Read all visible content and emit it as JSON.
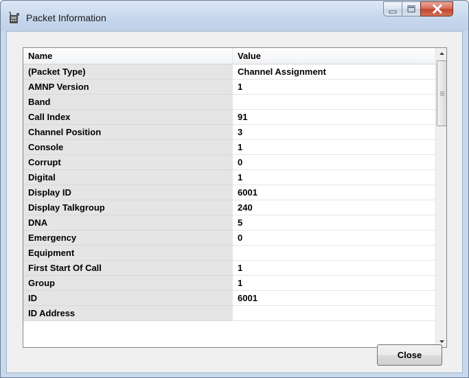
{
  "window": {
    "title": "Packet Information",
    "close_label": "Close"
  },
  "grid": {
    "headers": {
      "name": "Name",
      "value": "Value"
    },
    "rows": [
      {
        "name": "(Packet Type)",
        "value": "Channel Assignment"
      },
      {
        "name": "AMNP Version",
        "value": "1"
      },
      {
        "name": "Band",
        "value": ""
      },
      {
        "name": "Call Index",
        "value": "91"
      },
      {
        "name": "Channel Position",
        "value": "3"
      },
      {
        "name": "Console",
        "value": "1"
      },
      {
        "name": "Corrupt",
        "value": "0"
      },
      {
        "name": "Digital",
        "value": "1"
      },
      {
        "name": "Display ID",
        "value": "6001"
      },
      {
        "name": "Display Talkgroup",
        "value": "240"
      },
      {
        "name": "DNA",
        "value": "5"
      },
      {
        "name": "Emergency",
        "value": "0"
      },
      {
        "name": "Equipment",
        "value": ""
      },
      {
        "name": "First Start Of Call",
        "value": "1"
      },
      {
        "name": "Group",
        "value": "1"
      },
      {
        "name": "ID",
        "value": "6001"
      },
      {
        "name": "ID Address",
        "value": ""
      }
    ]
  },
  "icons": {
    "app": "radio-icon",
    "minimize": "minimize-icon",
    "maximize": "maximize-icon",
    "close": "close-x-icon",
    "scroll_up": "scroll-up-arrow-icon",
    "scroll_down": "scroll-down-arrow-icon"
  }
}
